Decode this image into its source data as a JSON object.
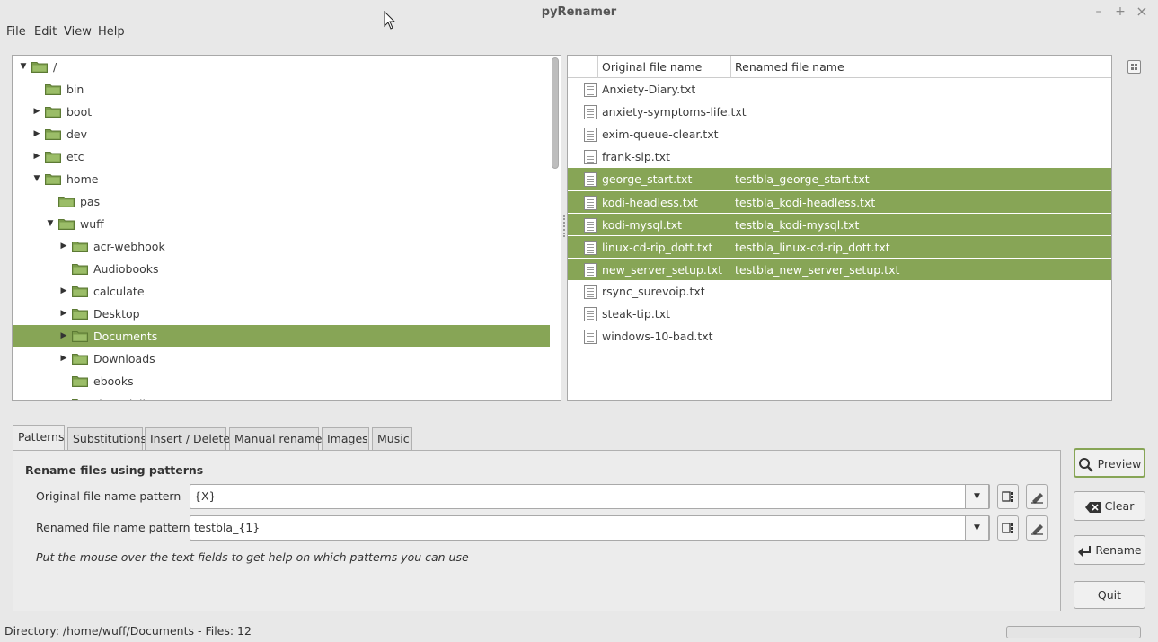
{
  "window": {
    "title": "pyRenamer",
    "minimize": "–",
    "maximize": "+",
    "close": "×"
  },
  "menu": [
    "File",
    "Edit",
    "View",
    "Help"
  ],
  "tree": [
    {
      "label": "/",
      "depth": 0,
      "expander": "open"
    },
    {
      "label": "bin",
      "depth": 1,
      "expander": "none"
    },
    {
      "label": "boot",
      "depth": 1,
      "expander": "closed"
    },
    {
      "label": "dev",
      "depth": 1,
      "expander": "closed"
    },
    {
      "label": "etc",
      "depth": 1,
      "expander": "closed"
    },
    {
      "label": "home",
      "depth": 1,
      "expander": "open"
    },
    {
      "label": "pas",
      "depth": 2,
      "expander": "none"
    },
    {
      "label": "wuff",
      "depth": 2,
      "expander": "open"
    },
    {
      "label": "acr-webhook",
      "depth": 3,
      "expander": "closed"
    },
    {
      "label": "Audiobooks",
      "depth": 3,
      "expander": "none"
    },
    {
      "label": "calculate",
      "depth": 3,
      "expander": "closed"
    },
    {
      "label": "Desktop",
      "depth": 3,
      "expander": "closed"
    },
    {
      "label": "Documents",
      "depth": 3,
      "expander": "closed",
      "selected": true
    },
    {
      "label": "Downloads",
      "depth": 3,
      "expander": "closed"
    },
    {
      "label": "ebooks",
      "depth": 3,
      "expander": "none"
    },
    {
      "label": "Finanzielles",
      "depth": 3,
      "expander": "closed"
    }
  ],
  "files": {
    "columns": [
      "Original file name",
      "Renamed file name"
    ],
    "rows": [
      {
        "original": "Anxiety-Diary.txt",
        "renamed": ""
      },
      {
        "original": "anxiety-symptoms-life.txt",
        "renamed": ""
      },
      {
        "original": "exim-queue-clear.txt",
        "renamed": ""
      },
      {
        "original": "frank-sip.txt",
        "renamed": ""
      },
      {
        "original": "george_start.txt",
        "renamed": "testbla_george_start.txt",
        "selected": true
      },
      {
        "original": "kodi-headless.txt",
        "renamed": "testbla_kodi-headless.txt",
        "selected": true
      },
      {
        "original": "kodi-mysql.txt",
        "renamed": "testbla_kodi-mysql.txt",
        "selected": true
      },
      {
        "original": "linux-cd-rip_dott.txt",
        "renamed": "testbla_linux-cd-rip_dott.txt",
        "selected": true
      },
      {
        "original": "new_server_setup.txt",
        "renamed": "testbla_new_server_setup.txt",
        "selected": true
      },
      {
        "original": "rsync_surevoip.txt",
        "renamed": ""
      },
      {
        "original": "steak-tip.txt",
        "renamed": ""
      },
      {
        "original": "windows-10-bad.txt",
        "renamed": ""
      }
    ]
  },
  "tabs": [
    "Patterns",
    "Substitutions",
    "Insert / Delete",
    "Manual rename",
    "Images",
    "Music"
  ],
  "patterns": {
    "heading": "Rename files using patterns",
    "original_label": "Original file name pattern",
    "original_value": "{X}",
    "renamed_label": "Renamed file name pattern",
    "renamed_value": "testbla_{1}",
    "hint": "Put the mouse over the text fields to get help on which patterns you can use"
  },
  "buttons": {
    "preview": "Preview",
    "clear": "Clear",
    "rename": "Rename",
    "quit": "Quit"
  },
  "status": "Directory: /home/wuff/Documents - Files: 12",
  "progress": 0,
  "colors": {
    "selection": "#87a556",
    "window": "#e8e8e8"
  }
}
